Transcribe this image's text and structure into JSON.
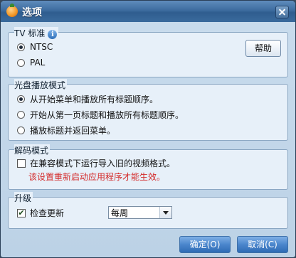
{
  "window": {
    "title": "选项"
  },
  "tv_standard": {
    "label": "TV 标准",
    "options": [
      "NTSC",
      "PAL"
    ],
    "selected": "NTSC",
    "help_label": "帮助"
  },
  "disc_mode": {
    "label": "光盘播放模式",
    "options": [
      "从开始菜单和播放所有标题顺序。",
      "开始从第一页标题和播放所有标题顺序。",
      "播放标题并返回菜单。"
    ],
    "selected": "从开始菜单和播放所有标题顺序。"
  },
  "decode_mode": {
    "label": "解码模式",
    "compat_label": "在兼容模式下运行导入旧的视频格式。",
    "compat_checked": false,
    "warning": "该设置重新启动应用程序才能生效。"
  },
  "upgrade": {
    "label": "升级",
    "check_label": "检查更新",
    "check_checked": true,
    "frequency": "每周"
  },
  "footer": {
    "ok_label": "确定(O)",
    "cancel_label": "取消(C)"
  },
  "colors": {
    "title_bar": "#3d6c9f",
    "warning": "#d42b2b",
    "primary_button": "#4b86cc"
  },
  "icons": [
    "app-logo-icon",
    "close-icon",
    "info-icon",
    "chevron-down-icon"
  ]
}
